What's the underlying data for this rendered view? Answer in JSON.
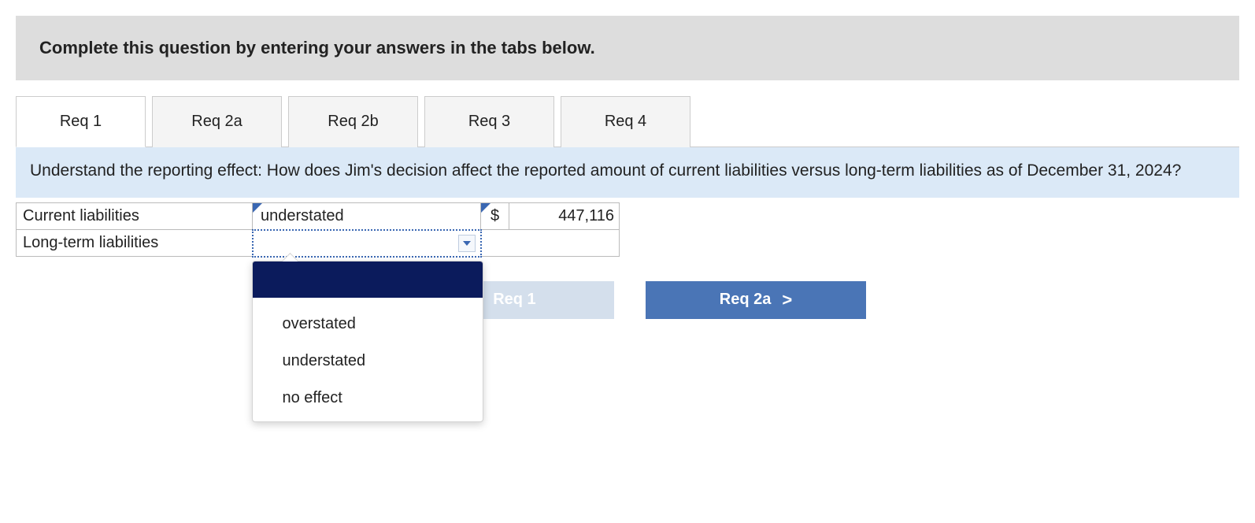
{
  "instruction": "Complete this question by entering your answers in the tabs below.",
  "tabs": [
    {
      "label": "Req 1",
      "active": true
    },
    {
      "label": "Req 2a",
      "active": false
    },
    {
      "label": "Req 2b",
      "active": false
    },
    {
      "label": "Req 3",
      "active": false
    },
    {
      "label": "Req 4",
      "active": false
    }
  ],
  "prompt": "Understand the reporting effect: How does Jim's decision affect the reported amount of current liabilities versus long-term liabilities as of December 31, 2024?",
  "rows": [
    {
      "label": "Current liabilities",
      "selection": "understated",
      "currency": "$",
      "amount": "447,116",
      "open": false
    },
    {
      "label": "Long-term liabilities",
      "selection": "",
      "currency": "",
      "amount": "",
      "open": true
    }
  ],
  "dropdown_options": [
    "",
    "overstated",
    "understated",
    "no effect"
  ],
  "nav": {
    "prev": {
      "label": "Req 1",
      "chevron": "<"
    },
    "next": {
      "label": "Req 2a",
      "chevron": ">"
    }
  }
}
